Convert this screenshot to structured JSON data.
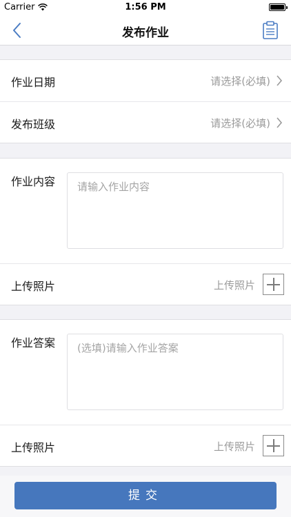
{
  "status_bar": {
    "carrier": "Carrier",
    "time": "1:56 PM"
  },
  "nav": {
    "title": "发布作业"
  },
  "form": {
    "date": {
      "label": "作业日期",
      "value": "请选择(必填)"
    },
    "class": {
      "label": "发布班级",
      "value": "请选择(必填)"
    },
    "content": {
      "label": "作业内容",
      "placeholder": "请输入作业内容",
      "upload_label": "上传照片",
      "upload_hint": "上传照片"
    },
    "answer": {
      "label": "作业答案",
      "placeholder": "(选填)请输入作业答案",
      "upload_label": "上传照片",
      "upload_hint": "上传照片"
    }
  },
  "submit": {
    "label": "提交"
  },
  "colors": {
    "accent": "#4677bd",
    "nav_icon": "#4a7cc3"
  }
}
